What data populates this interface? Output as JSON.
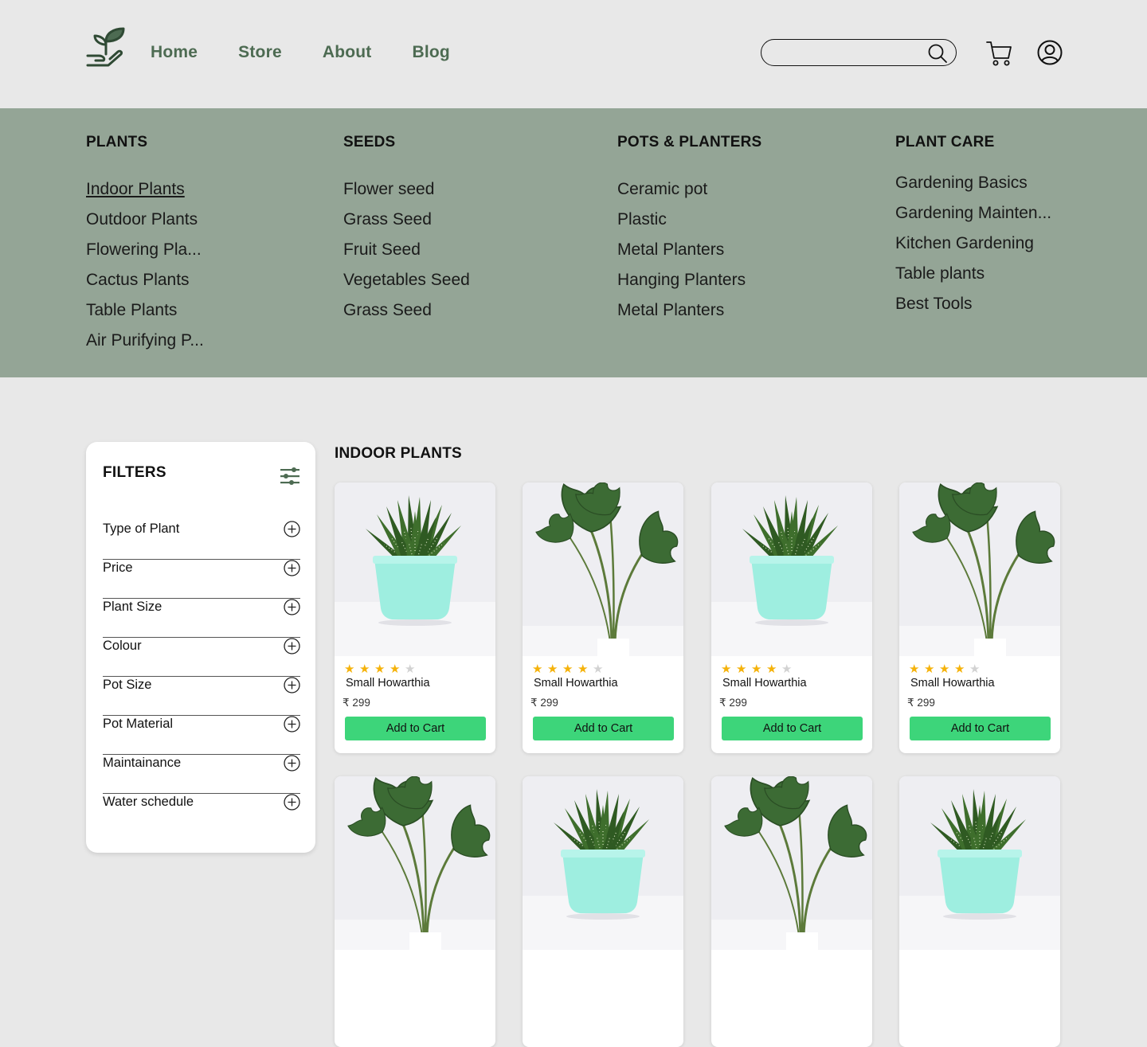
{
  "header": {
    "nav": [
      "Home",
      "Store",
      "About",
      "Blog"
    ],
    "search_value": ""
  },
  "mega_menu": [
    {
      "heading": "PLANTS",
      "items": [
        "Indoor Plants",
        "Outdoor Plants",
        "Flowering Pla...",
        "Cactus Plants",
        "Table Plants",
        "Air Purifying P..."
      ]
    },
    {
      "heading": "SEEDS",
      "items": [
        "Flower seed",
        "Grass Seed",
        "Fruit Seed",
        "Vegetables Seed",
        "Grass Seed"
      ]
    },
    {
      "heading": "POTS & PLANTERS",
      "items": [
        "Ceramic pot",
        "Plastic",
        "Metal Planters",
        "Hanging Planters",
        "Metal Planters"
      ]
    },
    {
      "heading": "PLANT CARE",
      "items": [
        "Gardening Basics",
        "Gardening Mainten...",
        "Kitchen Gardening",
        "Table plants",
        "Best Tools"
      ]
    }
  ],
  "filters": {
    "title": "FILTERS",
    "items": [
      "Type of Plant",
      "Price",
      "Plant Size",
      "Colour",
      "Pot Size",
      "Pot Material",
      "Maintainance",
      "Water schedule"
    ]
  },
  "products_section": {
    "title": "INDOOR PLANTS",
    "cards": [
      {
        "name": "Small Howarthia",
        "price": "₹ 299",
        "rating": 4,
        "image": "haworthia",
        "button": "Add to Cart"
      },
      {
        "name": "Small Howarthia",
        "price": "₹ 299",
        "rating": 4,
        "image": "alocasia",
        "button": "Add to Cart"
      },
      {
        "name": "Small Howarthia",
        "price": "₹ 299",
        "rating": 4,
        "image": "haworthia",
        "button": "Add to Cart"
      },
      {
        "name": "Small Howarthia",
        "price": "₹ 299",
        "rating": 4,
        "image": "alocasia",
        "button": "Add to Cart"
      },
      {
        "image": "alocasia"
      },
      {
        "image": "haworthia"
      },
      {
        "image": "alocasia"
      },
      {
        "image": "haworthia"
      }
    ]
  },
  "colors": {
    "accent_green": "#3dd57a",
    "menu_bg": "#94a596",
    "nav_text": "#4d6b52",
    "star": "#f5b20a",
    "pot": "#9eeee0"
  }
}
